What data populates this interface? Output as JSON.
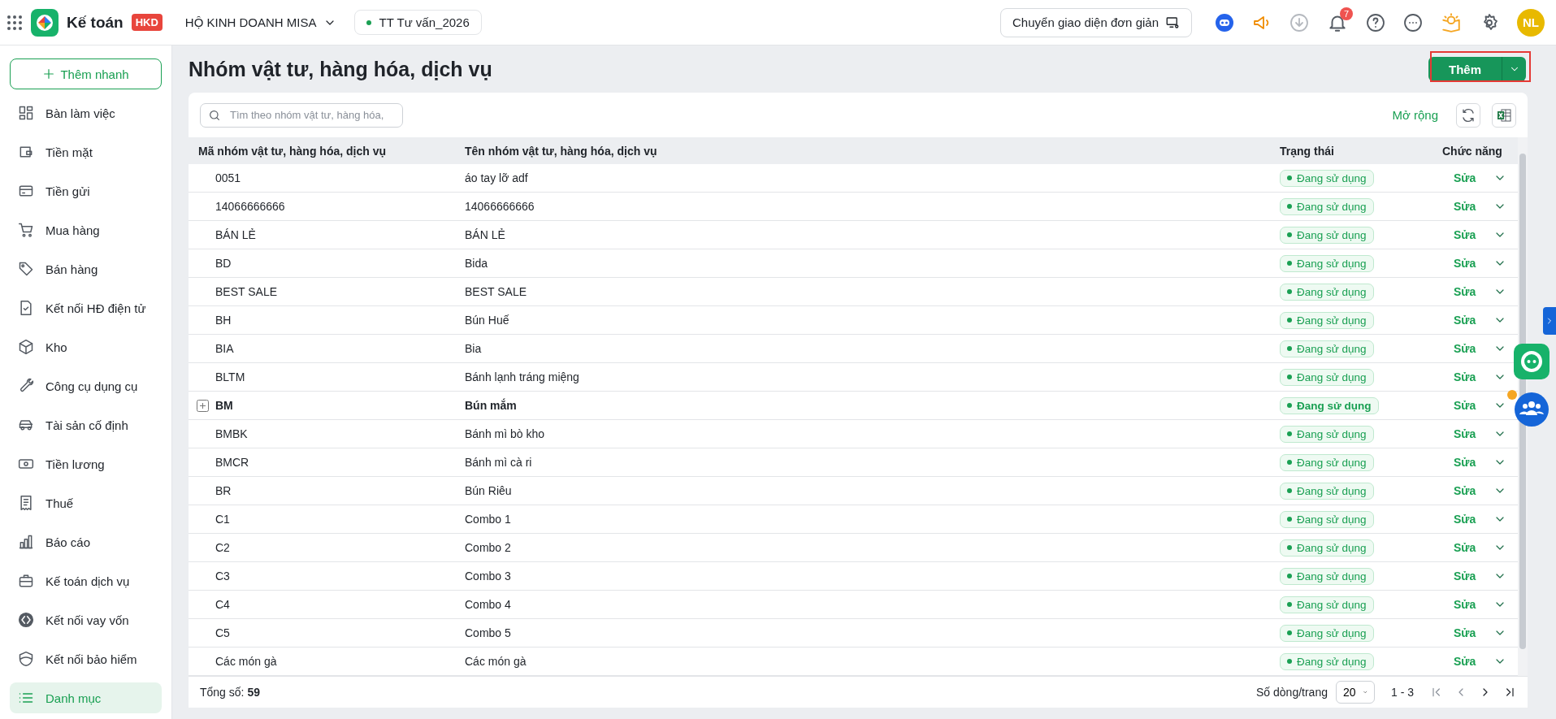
{
  "app": {
    "name": "Kế toán",
    "badge": "HKD"
  },
  "company": "HỘ KINH DOANH MISA",
  "branch": "TT Tư vấn_2026",
  "simple_mode_button": "Chuyển giao diện đơn giản",
  "notification_count": "7",
  "avatar_initials": "NL",
  "sidebar": {
    "quick_add": "Thêm nhanh",
    "items": [
      {
        "label": "Bàn làm việc",
        "selected": false
      },
      {
        "label": "Tiền mặt",
        "selected": false
      },
      {
        "label": "Tiền gửi",
        "selected": false
      },
      {
        "label": "Mua hàng",
        "selected": false
      },
      {
        "label": "Bán hàng",
        "selected": false
      },
      {
        "label": "Kết nối HĐ điện tử",
        "selected": false
      },
      {
        "label": "Kho",
        "selected": false
      },
      {
        "label": "Công cụ dụng cụ",
        "selected": false
      },
      {
        "label": "Tài sản cố định",
        "selected": false
      },
      {
        "label": "Tiền lương",
        "selected": false
      },
      {
        "label": "Thuế",
        "selected": false
      },
      {
        "label": "Báo cáo",
        "selected": false
      },
      {
        "label": "Kế toán dịch vụ",
        "selected": false
      },
      {
        "label": "Kết nối vay vốn",
        "selected": false
      },
      {
        "label": "Kết nối bảo hiểm",
        "selected": false
      },
      {
        "label": "Danh mục",
        "selected": true
      }
    ]
  },
  "page": {
    "title": "Nhóm vật tư, hàng hóa, dịch vụ",
    "add_button": "Thêm"
  },
  "toolbar": {
    "search_placeholder": "Tìm theo nhóm vật tư, hàng hóa,",
    "expand_link": "Mở rộng"
  },
  "table": {
    "columns": [
      "Mã nhóm vật tư, hàng hóa, dịch vụ",
      "Tên nhóm vật tư, hàng hóa, dịch vụ",
      "Trạng thái",
      "Chức năng"
    ],
    "rows": [
      {
        "kind": "item",
        "code": "0051",
        "name": "áo tay lỡ adf",
        "status": "Đang sử dụng",
        "action": "Sửa"
      },
      {
        "kind": "item",
        "code": "14066666666",
        "name": "14066666666",
        "status": "Đang sử dụng",
        "action": "Sửa"
      },
      {
        "kind": "item",
        "code": "BÁN LẺ",
        "name": "BÁN LẺ",
        "status": "Đang sử dụng",
        "action": "Sửa"
      },
      {
        "kind": "item",
        "code": "BD",
        "name": "Bida",
        "status": "Đang sử dụng",
        "action": "Sửa"
      },
      {
        "kind": "item",
        "code": "BEST SALE",
        "name": "BEST SALE",
        "status": "Đang sử dụng",
        "action": "Sửa"
      },
      {
        "kind": "item",
        "code": "BH",
        "name": "Bún Huế",
        "status": "Đang sử dụng",
        "action": "Sửa"
      },
      {
        "kind": "item",
        "code": "BIA",
        "name": "Bia",
        "status": "Đang sử dụng",
        "action": "Sửa"
      },
      {
        "kind": "item",
        "code": "BLTM",
        "name": "Bánh lạnh tráng miệng",
        "status": "Đang sử dụng",
        "action": "Sửa"
      },
      {
        "kind": "group",
        "code": "BM",
        "name": "Bún mắm",
        "status": "Đang sử dụng",
        "action": "Sửa"
      },
      {
        "kind": "item",
        "code": "BMBK",
        "name": "Bánh mì bò kho",
        "status": "Đang sử dụng",
        "action": "Sửa"
      },
      {
        "kind": "item",
        "code": "BMCR",
        "name": "Bánh mì cà ri",
        "status": "Đang sử dụng",
        "action": "Sửa"
      },
      {
        "kind": "item",
        "code": "BR",
        "name": "Bún Riêu",
        "status": "Đang sử dụng",
        "action": "Sửa"
      },
      {
        "kind": "item",
        "code": "C1",
        "name": "Combo 1",
        "status": "Đang sử dụng",
        "action": "Sửa"
      },
      {
        "kind": "item",
        "code": "C2",
        "name": "Combo 2",
        "status": "Đang sử dụng",
        "action": "Sửa"
      },
      {
        "kind": "item",
        "code": "C3",
        "name": "Combo 3",
        "status": "Đang sử dụng",
        "action": "Sửa"
      },
      {
        "kind": "item",
        "code": "C4",
        "name": "Combo 4",
        "status": "Đang sử dụng",
        "action": "Sửa"
      },
      {
        "kind": "item",
        "code": "C5",
        "name": "Combo 5",
        "status": "Đang sử dụng",
        "action": "Sửa"
      },
      {
        "kind": "item",
        "code": "Các món gà",
        "name": "Các món gà",
        "status": "Đang sử dụng",
        "action": "Sửa"
      }
    ]
  },
  "footer": {
    "total_label": "Tổng số:",
    "total": "59",
    "page_size_label": "Số dòng/trang",
    "page_size": "20",
    "range": "1 - 3"
  }
}
